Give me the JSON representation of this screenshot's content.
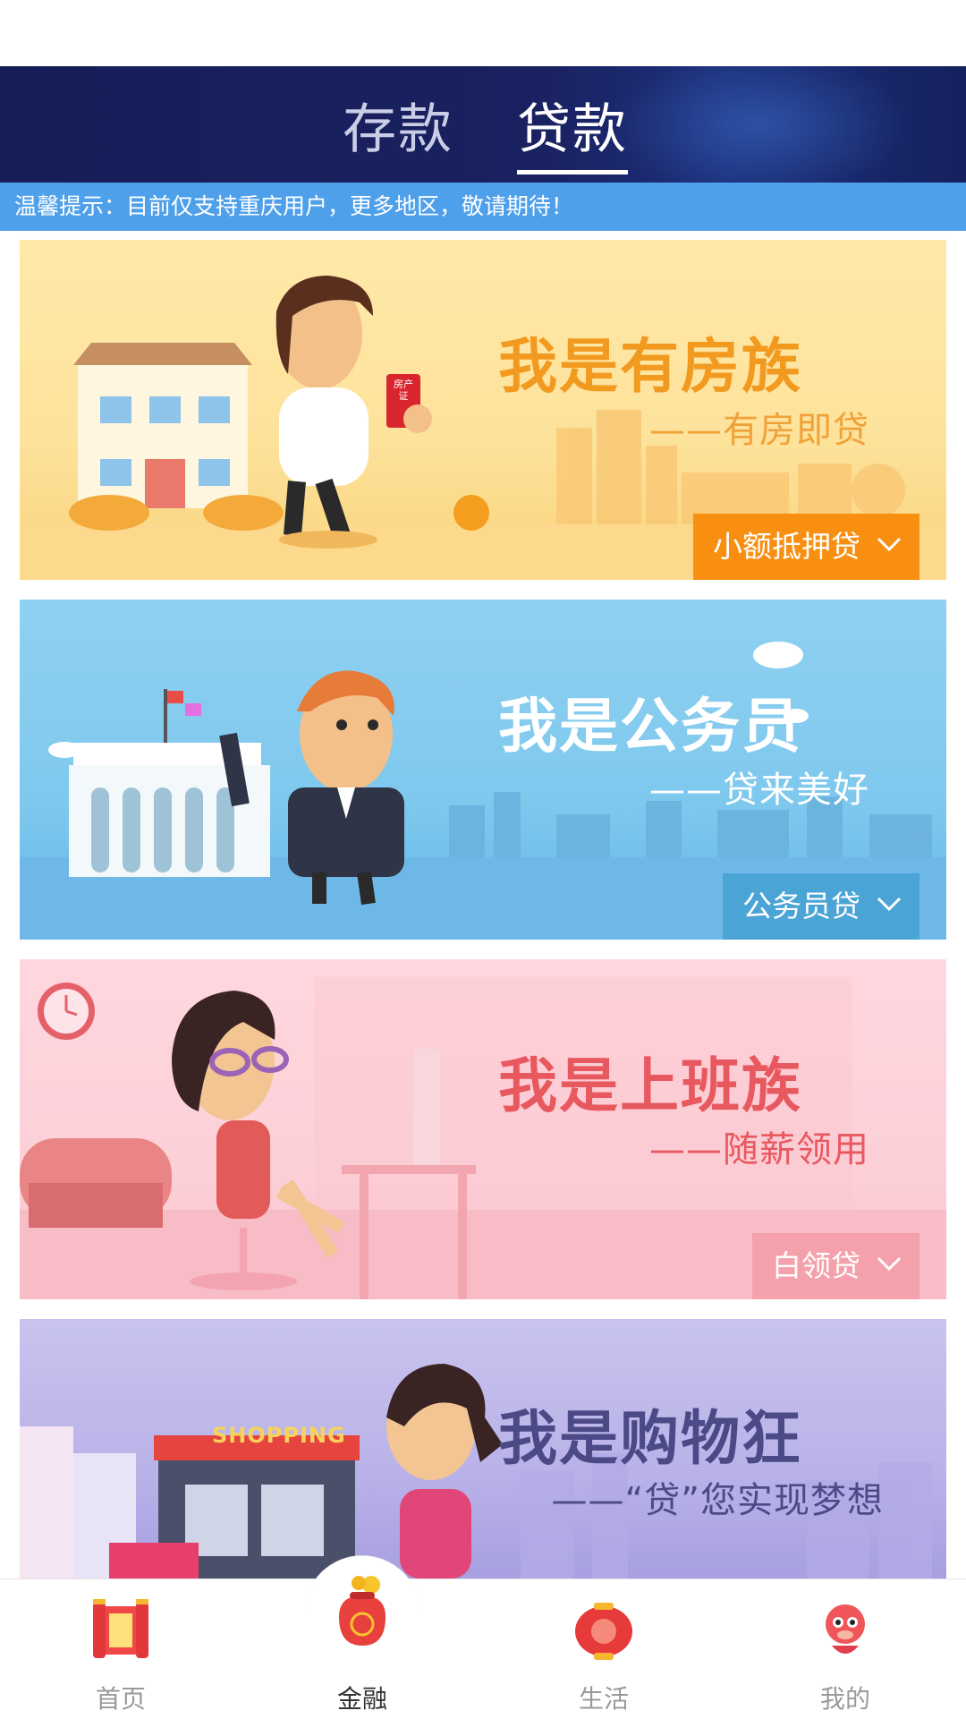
{
  "header": {
    "tabs": [
      {
        "label": "存款",
        "active": false
      },
      {
        "label": "贷款",
        "active": true
      }
    ]
  },
  "notice": {
    "text": "温馨提示：目前仅支持重庆用户，更多地区，敬请期待！"
  },
  "banners": [
    {
      "headline": "我是有房族",
      "subline": "——有房即贷",
      "cta": "小额抵押贷",
      "color": "#f88f11"
    },
    {
      "headline": "我是公务员",
      "subline": "——贷来美好",
      "cta": "公务员贷",
      "color": "#4aa4d6"
    },
    {
      "headline": "我是上班族",
      "subline": "——随薪领用",
      "cta": "白领贷",
      "color": "#f4a1ab"
    },
    {
      "headline": "我是购物狂",
      "subline": "——“贷”您实现梦想",
      "shop_sign": "SHOPPING"
    }
  ],
  "certificate_text": "房产证",
  "tabbar": {
    "items": [
      {
        "label": "首页",
        "icon": "lantern-scroll-icon",
        "active": false
      },
      {
        "label": "金融",
        "icon": "money-bag-icon",
        "active": true
      },
      {
        "label": "生活",
        "icon": "red-lantern-icon",
        "active": false
      },
      {
        "label": "我的",
        "icon": "mascot-icon",
        "active": false
      }
    ]
  }
}
